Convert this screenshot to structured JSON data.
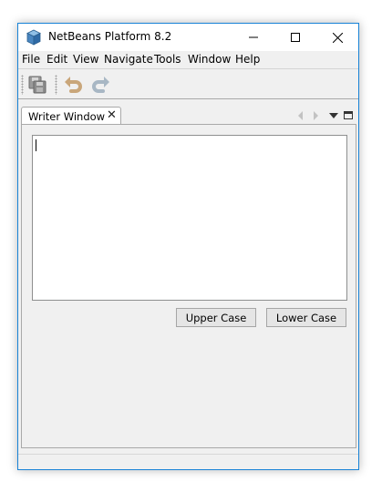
{
  "window": {
    "title": "NetBeans Platform 8.2"
  },
  "menu": {
    "items": [
      "File",
      "Edit",
      "View",
      "Navigate",
      "Tools",
      "Window",
      "Help"
    ]
  },
  "toolbar": {
    "icons": [
      "save-all-icon",
      "undo-icon",
      "redo-icon"
    ]
  },
  "editor": {
    "tab_label": "Writer Window",
    "tab_close": "✕",
    "text_value": ""
  },
  "buttons": {
    "upper_case": "Upper Case",
    "lower_case": "Lower Case"
  },
  "colors": {
    "window_border": "#1883d7",
    "background": "#f0f0f0"
  }
}
